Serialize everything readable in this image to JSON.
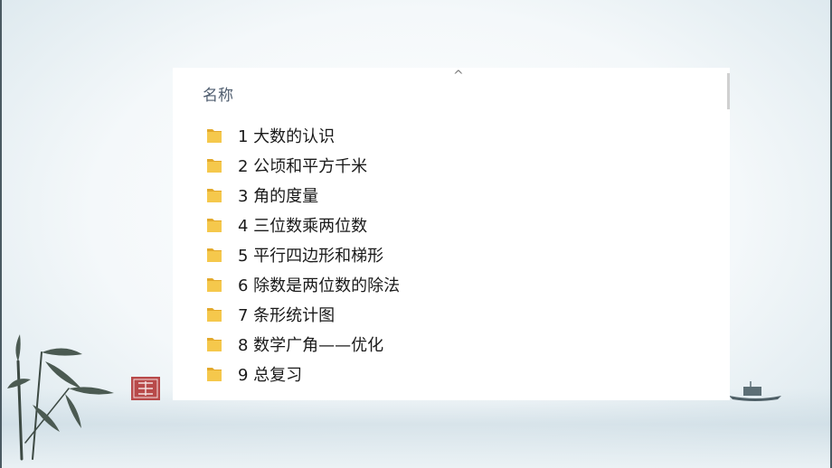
{
  "explorer": {
    "column_header": "名称",
    "scroll_up_glyph": "^",
    "items": [
      {
        "label": "1 大数的认识",
        "icon": "folder-icon"
      },
      {
        "label": "2 公顷和平方千米",
        "icon": "folder-icon"
      },
      {
        "label": "3 角的度量",
        "icon": "folder-icon"
      },
      {
        "label": "4 三位数乘两位数",
        "icon": "folder-icon"
      },
      {
        "label": "5 平行四边形和梯形",
        "icon": "folder-icon"
      },
      {
        "label": "6 除数是两位数的除法",
        "icon": "folder-icon"
      },
      {
        "label": "7 条形统计图",
        "icon": "folder-icon"
      },
      {
        "label": "8 数学广角——优化",
        "icon": "folder-icon"
      },
      {
        "label": "9 总复习",
        "icon": "folder-icon"
      }
    ]
  },
  "colors": {
    "folder_yellow": "#f5c84c",
    "folder_shade": "#e3a92b",
    "frame": "#4a5a62"
  }
}
